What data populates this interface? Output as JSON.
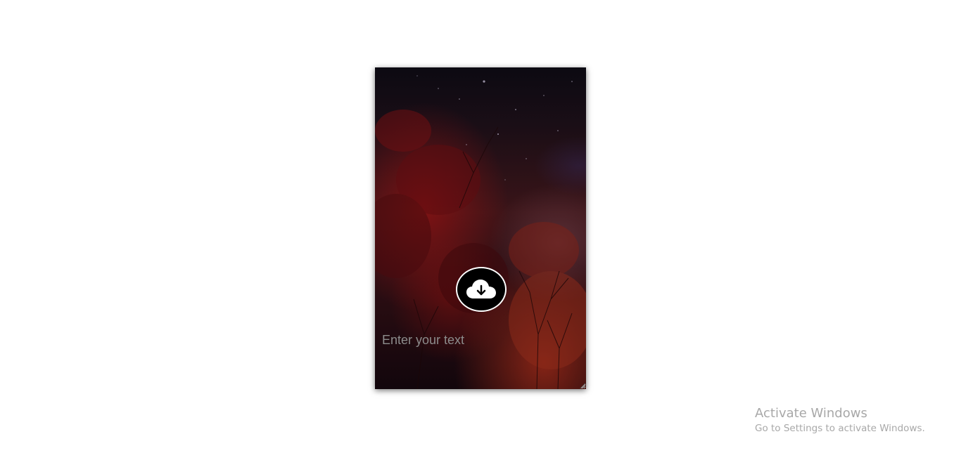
{
  "card": {
    "background": "autumn-trees-night-sky-image",
    "upload_button": {
      "icon": "cloud-download-icon",
      "color": "#000000",
      "border_color": "#ffffff"
    },
    "text_input": {
      "value": "",
      "placeholder": "Enter your text"
    }
  },
  "watermark": {
    "title": "Activate Windows",
    "subtitle": "Go to Settings to activate Windows."
  }
}
